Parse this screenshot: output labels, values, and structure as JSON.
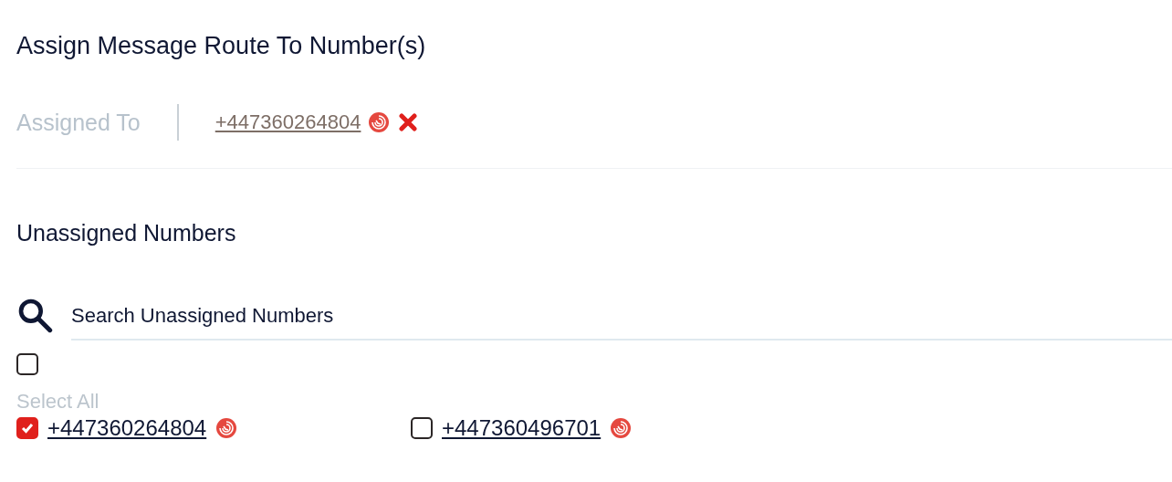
{
  "title": "Assign Message Route To Number(s)",
  "assigned": {
    "label": "Assigned To",
    "numbers": [
      {
        "number": "+447360264804"
      }
    ]
  },
  "unassigned": {
    "heading": "Unassigned Numbers",
    "search": {
      "placeholder": "Search Unassigned Numbers"
    },
    "select_all": {
      "label": "Select All",
      "checked": false
    },
    "numbers": [
      {
        "number": "+447360264804",
        "checked": true
      },
      {
        "number": "+447360496701",
        "checked": false
      }
    ]
  }
}
